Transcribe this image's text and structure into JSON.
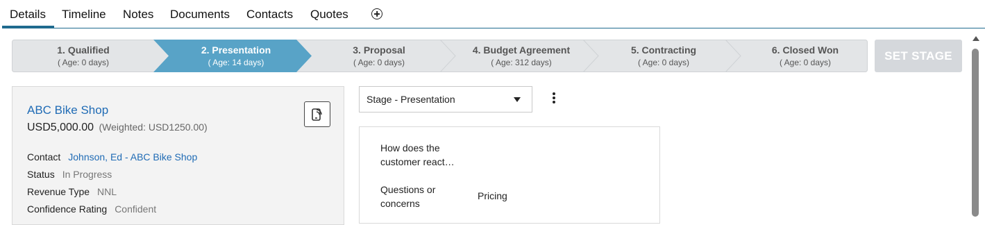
{
  "tabs": [
    {
      "label": "Details",
      "active": true
    },
    {
      "label": "Timeline"
    },
    {
      "label": "Notes"
    },
    {
      "label": "Documents"
    },
    {
      "label": "Contacts"
    },
    {
      "label": "Quotes"
    }
  ],
  "add_tab_icon": "plus-circle-icon",
  "stages": [
    {
      "name": "1. Qualified",
      "age": "( Age: 0 days)"
    },
    {
      "name": "2. Presentation",
      "age": "( Age: 14 days)",
      "active": true
    },
    {
      "name": "3. Proposal",
      "age": "( Age: 0 days)"
    },
    {
      "name": "4. Budget Agreement",
      "age": "( Age: 312 days)"
    },
    {
      "name": "5. Contracting",
      "age": "( Age: 0 days)"
    },
    {
      "name": "6. Closed Won",
      "age": "( Age: 0 days)"
    }
  ],
  "set_stage_label": "SET STAGE",
  "opportunity": {
    "name": "ABC Bike Shop",
    "amount": "USD5,000.00",
    "weighted": "(Weighted: USD1250.00)",
    "fields": [
      {
        "label": "Contact",
        "value": "Johnson, Ed - ABC Bike Shop",
        "link": true
      },
      {
        "label": "Status",
        "value": "In Progress"
      },
      {
        "label": "Revenue Type",
        "value": "NNL"
      },
      {
        "label": "Confidence Rating",
        "value": "Confident"
      }
    ]
  },
  "stage_select": {
    "value": "Stage - Presentation"
  },
  "qa": [
    {
      "question": "How does the customer react…",
      "answer": ""
    },
    {
      "question": "Questions or concerns",
      "answer": "Pricing"
    }
  ],
  "colors": {
    "accent": "#1f6b8f",
    "active_stage": "#58a3c7",
    "inactive_stage": "#e3e5e7",
    "link": "#1f6bb5",
    "button_disabled": "#d5d8dc"
  }
}
